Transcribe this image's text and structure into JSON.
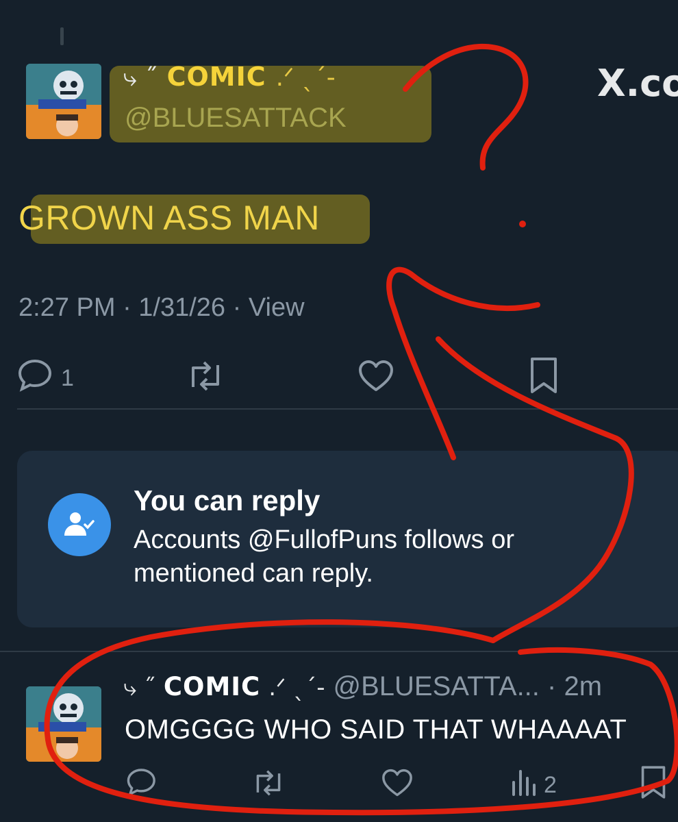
{
  "post": {
    "author_name": "COMIC",
    "name_decor_prefix": "⤷ ˝",
    "name_decor_suffix": ".ᐟ ˎˊ-",
    "handle": "@BLUESATTACK",
    "text": "GROWN ASS MAN",
    "timestamp": "2:27 PM · 1/31/26 · View",
    "reply_count": "1"
  },
  "brand": {
    "logo_text": "X.co"
  },
  "reply_notice": {
    "title": "You can reply",
    "body": "Accounts @FullofPuns follows or mentioned can reply."
  },
  "reply": {
    "name_decor_prefix": "⤷ ˝",
    "author_name": "COMIC",
    "name_decor_suffix": ".ᐟ ˎˊ-",
    "handle_time": "@BLUESATTA... · 2m",
    "text": "OMGGGG WHO SAID THAT WHAAAAT",
    "views": "2"
  },
  "icons": [
    "reply-icon",
    "retweet-icon",
    "like-icon",
    "bookmark-icon",
    "views-icon",
    "user-check-icon"
  ],
  "colors": {
    "background": "#15202b",
    "accent": "#1d9bf0",
    "highlight": "#c4aa19",
    "annotation_red": "#e0200f"
  }
}
